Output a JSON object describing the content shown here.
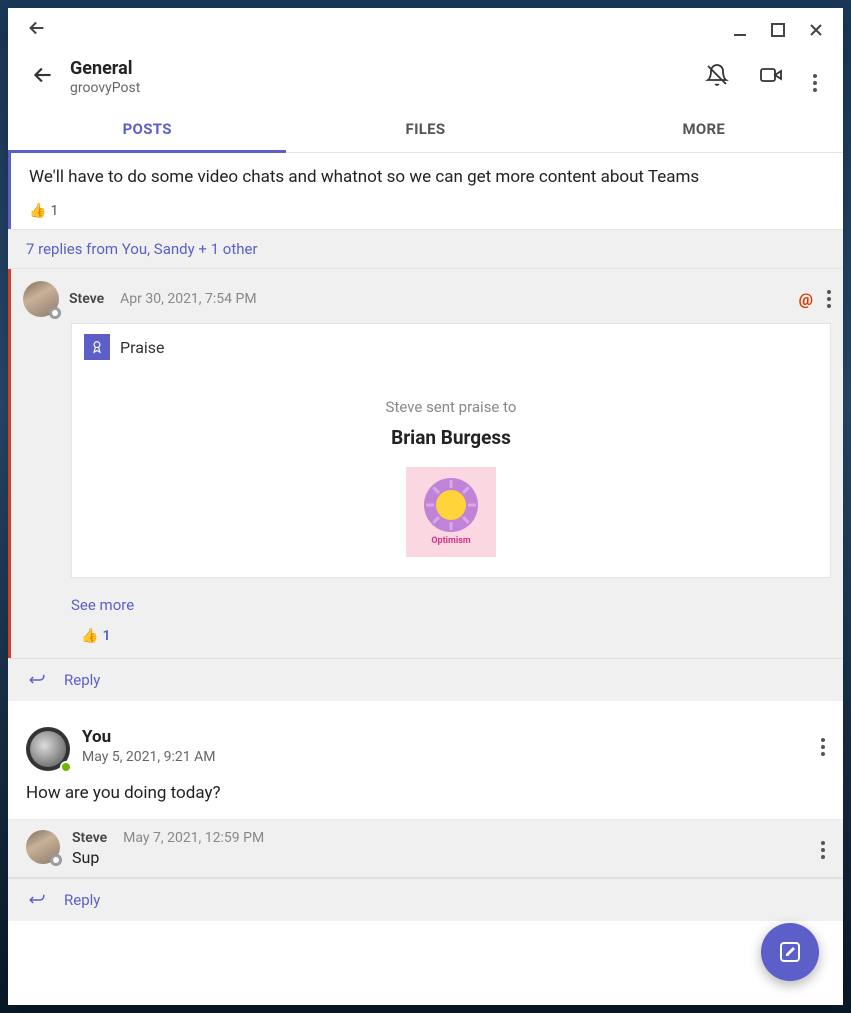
{
  "header": {
    "channel_title": "General",
    "team_name": "groovyPost"
  },
  "tabs": {
    "posts": "POSTS",
    "files": "FILES",
    "more": "MORE"
  },
  "conversation1": {
    "root_message": "We'll have to do some video chats and whatnot so we can get more content about Teams",
    "root_reaction_count": "1",
    "replies_summary": "7 replies from You, Sandy + 1 other",
    "steve_reply": {
      "author": "Steve",
      "timestamp": "Apr 30, 2021, 7:54 PM",
      "praise_label": "Praise",
      "praise_sent_line": "Steve sent praise to",
      "praise_recipient": "Brian Burgess",
      "praise_badge_text": "Optimism",
      "see_more": "See more",
      "reaction_count": "1"
    },
    "reply_action": "Reply"
  },
  "conversation2": {
    "author": "You",
    "timestamp": "May 5, 2021, 9:21 AM",
    "body": "How are you doing today?",
    "reply1": {
      "author": "Steve",
      "timestamp": "May 7, 2021, 12:59 PM",
      "body": "Sup"
    },
    "reply_action": "Reply"
  }
}
